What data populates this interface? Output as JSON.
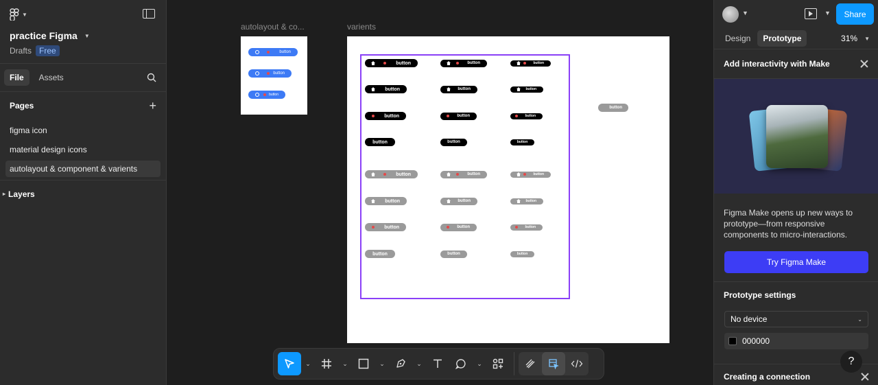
{
  "left_panel": {
    "file_title": "practice Figma",
    "drafts_label": "Drafts",
    "plan_badge": "Free",
    "tabs": [
      {
        "label": "File"
      },
      {
        "label": "Assets"
      }
    ],
    "pages_heading": "Pages",
    "pages": [
      {
        "label": "figma icon"
      },
      {
        "label": "material design icons"
      },
      {
        "label": "autolayout & component & varients"
      }
    ],
    "layers_heading": "Layers"
  },
  "canvas": {
    "frame1_label": "autolayout & co...",
    "frame2_label": "varients",
    "button_text": "button",
    "mini_buttons": [
      {
        "label": "button"
      },
      {
        "label": "button"
      },
      {
        "label": "button"
      }
    ],
    "loose_button": "button"
  },
  "right_panel": {
    "share_label": "Share",
    "tabs": [
      {
        "label": "Design"
      },
      {
        "label": "Prototype"
      }
    ],
    "zoom": "31%",
    "interactivity_heading": "Add interactivity with Make",
    "promo_text": "Figma Make opens up new ways to prototype—from responsive components to micro-interactions.",
    "try_button": "Try Figma Make",
    "prototype_settings": "Prototype settings",
    "device_value": "No device",
    "bg_color": "000000",
    "creating_connection": "Creating a connection",
    "help": "?"
  },
  "colors": {
    "accent": "#0d99ff",
    "selection": "#8a3ff7",
    "make_button": "#3d3df5"
  }
}
